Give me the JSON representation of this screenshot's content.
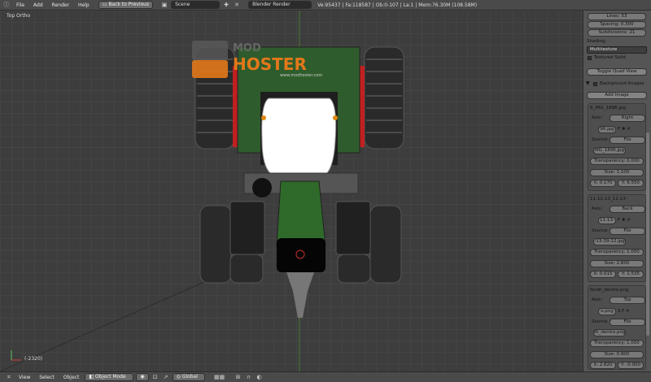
{
  "menu": {
    "file": "File",
    "add": "Add",
    "render": "Render",
    "help": "Help"
  },
  "header": {
    "back": "Back to Previous",
    "scene": "Scene",
    "engine": "Blender Render",
    "stats": "Ve:95437 | Fa:118587 | Ob:0-107 | La:1 | Mem:76.30M (108.58M)"
  },
  "viewport": {
    "title": "Top Ortho",
    "layer": "(-2320)",
    "watermark_main": "HOSTER",
    "watermark_top": "MOD",
    "watermark_url": "www.modhoster.com"
  },
  "footer": {
    "view": "View",
    "select": "Select",
    "object": "Object",
    "mode": "Object Mode",
    "orientation": "Global"
  },
  "panel": {
    "lines": "Lines: 53",
    "spacing": "Spacing: 0.300",
    "subdivisions": "Subdivisions: 21",
    "shading_label": "Shading:",
    "shading": "Multitexture",
    "textured_solid": "Textured Solid",
    "toggle_quad": "Toggle Quad View",
    "bg_images": "Background Images",
    "add_image": "Add Image",
    "images": [
      {
        "name": "6_IMG_1896.jpg",
        "axis": "Right",
        "file": "96.jpg",
        "source": "File",
        "filename": "MG_1896.jpg",
        "transparency": "Transparency: 0.000",
        "size": "Size: 1.100",
        "x": "X: 0.170",
        "y": "Y: 6.550"
      },
      {
        "name": "11-12-13_11-13-",
        "axis": "Back",
        "file": "11-13-",
        "source": "File",
        "filename": "-13-39-12.jpg",
        "transparency": "Transparency: 1.000",
        "size": "Size: 2.600",
        "x": "X: 0.015",
        "y": "Y: 1.535"
      },
      {
        "name": "fendt_dentro.png",
        "axis": "Top",
        "file": "o.png",
        "source": "File",
        "filename": "dt_dentro.png",
        "transparency": "Transparency: 1.000",
        "size": "Size: 0.900",
        "x": "X: 2.820",
        "y": "Y: -0.000"
      }
    ],
    "axis_label": "Axis:",
    "source_label": "Source:"
  }
}
